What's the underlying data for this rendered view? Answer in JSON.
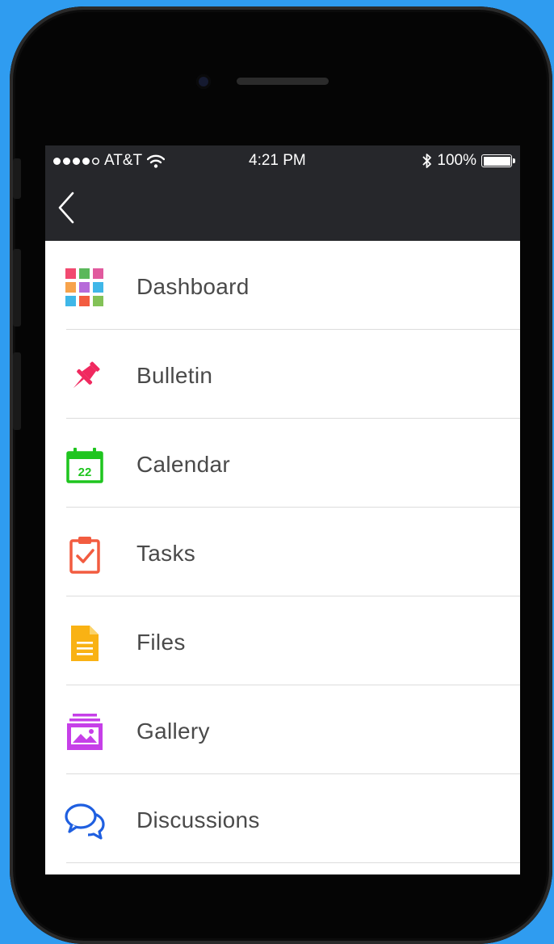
{
  "status_bar": {
    "carrier": "AT&T",
    "time": "4:21 PM",
    "battery": "100%",
    "signal_bars_filled": 4,
    "signal_bars_total": 5
  },
  "nav": {
    "back_icon": "chevron-left-icon"
  },
  "menu": {
    "items": [
      {
        "label": "Dashboard",
        "icon": "grid-icon"
      },
      {
        "label": "Bulletin",
        "icon": "pushpin-icon",
        "color": "#f0295f"
      },
      {
        "label": "Calendar",
        "icon": "calendar-icon",
        "color": "#1fc51f",
        "day": "22"
      },
      {
        "label": "Tasks",
        "icon": "clipboard-check-icon",
        "color": "#f25c40"
      },
      {
        "label": "Files",
        "icon": "document-icon",
        "color": "#f9b214"
      },
      {
        "label": "Gallery",
        "icon": "gallery-icon",
        "color": "#c63fe8"
      },
      {
        "label": "Discussions",
        "icon": "chat-bubbles-icon",
        "color": "#1f5fe0"
      }
    ]
  },
  "colors": {
    "background": "#2f9cf0",
    "nav_bar": "#26272b",
    "label_text": "#4a4a4a",
    "dashboard_tiles": [
      "#f24a70",
      "#5bb85b",
      "#e15a9e",
      "#f7a34b",
      "#b66ad9",
      "#3fb7e8",
      "#3fb7e8",
      "#f25c40",
      "#83c257"
    ]
  }
}
